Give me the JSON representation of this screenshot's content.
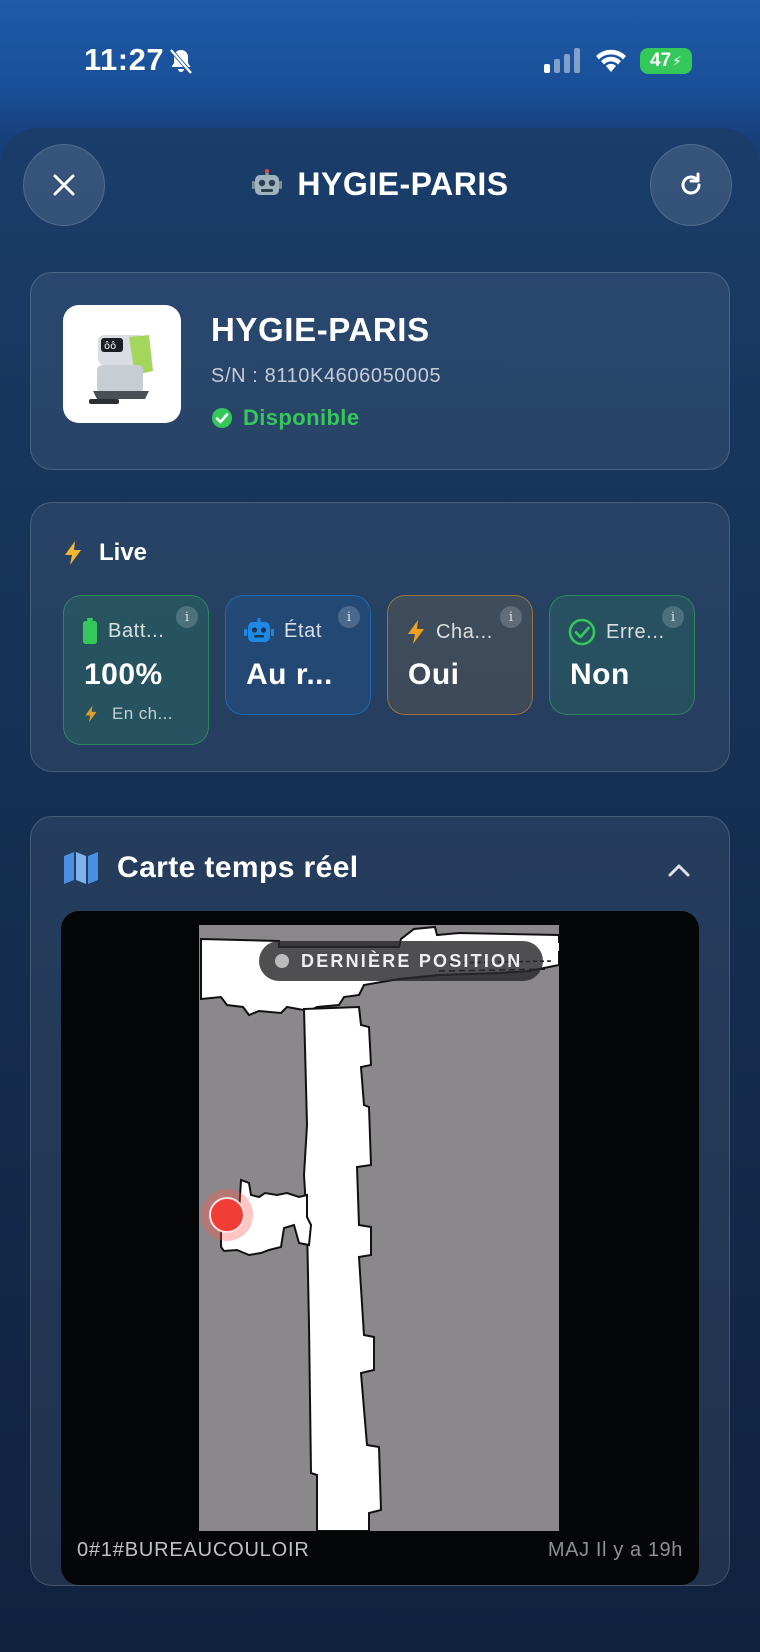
{
  "status_bar": {
    "time": "11:27",
    "battery_percent": "47"
  },
  "header": {
    "title": "HYGIE-PARIS",
    "close_icon": "close-icon",
    "refresh_icon": "refresh-icon"
  },
  "robot": {
    "name": "HYGIE-PARIS",
    "serial": "S/N : 8110K4606050005",
    "status": "Disponible",
    "status_color": "#34c759"
  },
  "live": {
    "title": "Live",
    "tiles": [
      {
        "label": "Batt...",
        "value": "100%",
        "sub": "En ch...",
        "icon": "battery-icon",
        "color": "#34c759"
      },
      {
        "label": "État",
        "value": "Au r...",
        "icon": "robot-icon",
        "color": "#1e88e5"
      },
      {
        "label": "Cha...",
        "value": "Oui",
        "icon": "bolt-icon",
        "color": "#f0a020"
      },
      {
        "label": "Erre...",
        "value": "Non",
        "icon": "check-circle-icon",
        "color": "#34c759"
      }
    ]
  },
  "map": {
    "title": "Carte temps réel",
    "badge": "DERNIÈRE POSITION",
    "floor": "0#1#BUREAUCOULOIR",
    "updated": "MAJ Il y a 19h"
  }
}
